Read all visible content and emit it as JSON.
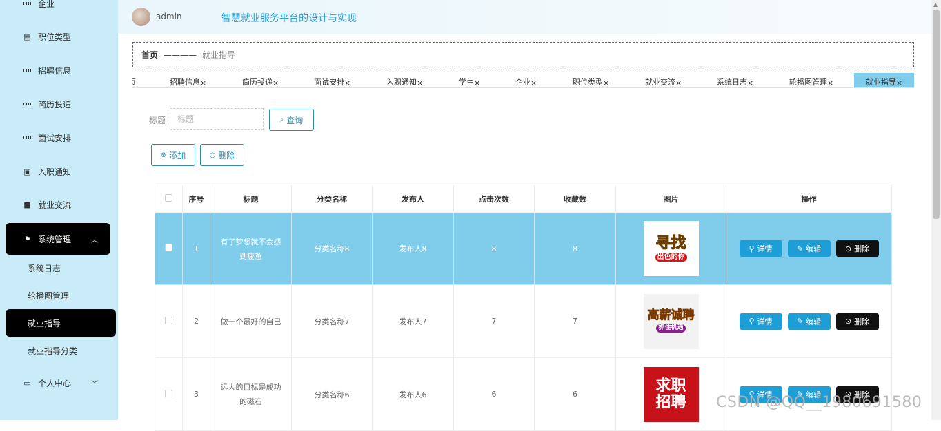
{
  "sidebar": {
    "items": [
      {
        "label": "企业",
        "icon": "grid-icon"
      },
      {
        "label": "职位类型",
        "icon": "clipboard-icon"
      },
      {
        "label": "招聘信息",
        "icon": "grid-icon"
      },
      {
        "label": "简历投递",
        "icon": "grid-icon"
      },
      {
        "label": "面试安排",
        "icon": "grid-icon"
      },
      {
        "label": "入职通知",
        "icon": "clipboard-check-icon"
      },
      {
        "label": "就业交流",
        "icon": "video-icon"
      },
      {
        "label": "系统管理",
        "icon": "flag-icon"
      },
      {
        "label": "个人中心",
        "icon": "card-icon"
      }
    ],
    "sub_items": [
      "系统日志",
      "轮播图管理",
      "就业指导",
      "就业指导分类"
    ]
  },
  "header": {
    "user": "admin",
    "title": "智慧就业服务平台的设计与实现"
  },
  "breadcrumb": {
    "home": "首页",
    "separator": "————",
    "current": "就业指导"
  },
  "tabs": [
    "页",
    "招聘信息",
    "简历投递",
    "面试安排",
    "入职通知",
    "学生",
    "企业",
    "职位类型",
    "就业交流",
    "系统日志",
    "轮播图管理",
    "就业指导"
  ],
  "tab_close": "×",
  "search": {
    "label": "标题",
    "placeholder": "标题",
    "button": "查询"
  },
  "actions": {
    "add": "添加",
    "delete": "删除"
  },
  "table": {
    "headers": [
      "序号",
      "标题",
      "分类名称",
      "发布人",
      "点击次数",
      "收藏数",
      "图片",
      "操作"
    ],
    "rows": [
      {
        "no": "1",
        "title_line1": "有了梦想就不会感",
        "title_line2": "到疲惫",
        "category": "分类名称8",
        "publisher": "发布人8",
        "clicks": "8",
        "favorites": "8",
        "img_line1": "寻找",
        "img_line2": "出色的你"
      },
      {
        "no": "2",
        "title_line1": "做一个最好的自己",
        "title_line2": "",
        "category": "分类名称7",
        "publisher": "发布人7",
        "clicks": "7",
        "favorites": "7",
        "img_line1": "高薪诚聘",
        "img_line2": "抓住机遇"
      },
      {
        "no": "3",
        "title_line1": "远大的目标是成功",
        "title_line2": "的磁石",
        "category": "分类名称6",
        "publisher": "发布人6",
        "clicks": "6",
        "favorites": "6",
        "img_line1": "求职",
        "img_line2": "招聘"
      }
    ],
    "ops": {
      "detail": "详情",
      "edit": "编辑",
      "delete": "删除"
    }
  },
  "watermark": "CSDN @QQ__1980691580",
  "colors": {
    "accent": "#1e9ed6",
    "highlight_row": "#7fcdea",
    "sidebar_bg": "#c9ecf8"
  }
}
